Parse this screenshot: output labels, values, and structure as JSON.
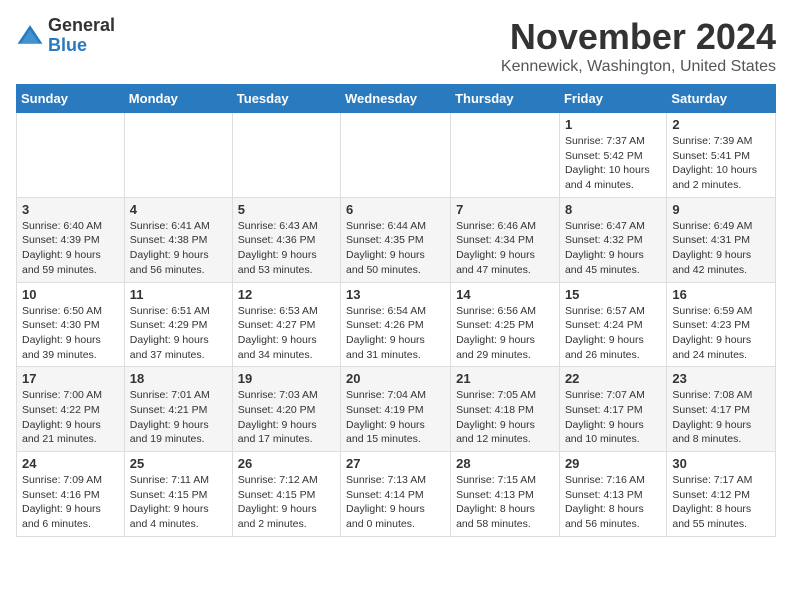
{
  "logo": {
    "line1": "General",
    "line2": "Blue"
  },
  "title": "November 2024",
  "subtitle": "Kennewick, Washington, United States",
  "weekdays": [
    "Sunday",
    "Monday",
    "Tuesday",
    "Wednesday",
    "Thursday",
    "Friday",
    "Saturday"
  ],
  "weeks": [
    [
      {
        "day": "",
        "info": ""
      },
      {
        "day": "",
        "info": ""
      },
      {
        "day": "",
        "info": ""
      },
      {
        "day": "",
        "info": ""
      },
      {
        "day": "",
        "info": ""
      },
      {
        "day": "1",
        "info": "Sunrise: 7:37 AM\nSunset: 5:42 PM\nDaylight: 10 hours and 4 minutes."
      },
      {
        "day": "2",
        "info": "Sunrise: 7:39 AM\nSunset: 5:41 PM\nDaylight: 10 hours and 2 minutes."
      }
    ],
    [
      {
        "day": "3",
        "info": "Sunrise: 6:40 AM\nSunset: 4:39 PM\nDaylight: 9 hours and 59 minutes."
      },
      {
        "day": "4",
        "info": "Sunrise: 6:41 AM\nSunset: 4:38 PM\nDaylight: 9 hours and 56 minutes."
      },
      {
        "day": "5",
        "info": "Sunrise: 6:43 AM\nSunset: 4:36 PM\nDaylight: 9 hours and 53 minutes."
      },
      {
        "day": "6",
        "info": "Sunrise: 6:44 AM\nSunset: 4:35 PM\nDaylight: 9 hours and 50 minutes."
      },
      {
        "day": "7",
        "info": "Sunrise: 6:46 AM\nSunset: 4:34 PM\nDaylight: 9 hours and 47 minutes."
      },
      {
        "day": "8",
        "info": "Sunrise: 6:47 AM\nSunset: 4:32 PM\nDaylight: 9 hours and 45 minutes."
      },
      {
        "day": "9",
        "info": "Sunrise: 6:49 AM\nSunset: 4:31 PM\nDaylight: 9 hours and 42 minutes."
      }
    ],
    [
      {
        "day": "10",
        "info": "Sunrise: 6:50 AM\nSunset: 4:30 PM\nDaylight: 9 hours and 39 minutes."
      },
      {
        "day": "11",
        "info": "Sunrise: 6:51 AM\nSunset: 4:29 PM\nDaylight: 9 hours and 37 minutes."
      },
      {
        "day": "12",
        "info": "Sunrise: 6:53 AM\nSunset: 4:27 PM\nDaylight: 9 hours and 34 minutes."
      },
      {
        "day": "13",
        "info": "Sunrise: 6:54 AM\nSunset: 4:26 PM\nDaylight: 9 hours and 31 minutes."
      },
      {
        "day": "14",
        "info": "Sunrise: 6:56 AM\nSunset: 4:25 PM\nDaylight: 9 hours and 29 minutes."
      },
      {
        "day": "15",
        "info": "Sunrise: 6:57 AM\nSunset: 4:24 PM\nDaylight: 9 hours and 26 minutes."
      },
      {
        "day": "16",
        "info": "Sunrise: 6:59 AM\nSunset: 4:23 PM\nDaylight: 9 hours and 24 minutes."
      }
    ],
    [
      {
        "day": "17",
        "info": "Sunrise: 7:00 AM\nSunset: 4:22 PM\nDaylight: 9 hours and 21 minutes."
      },
      {
        "day": "18",
        "info": "Sunrise: 7:01 AM\nSunset: 4:21 PM\nDaylight: 9 hours and 19 minutes."
      },
      {
        "day": "19",
        "info": "Sunrise: 7:03 AM\nSunset: 4:20 PM\nDaylight: 9 hours and 17 minutes."
      },
      {
        "day": "20",
        "info": "Sunrise: 7:04 AM\nSunset: 4:19 PM\nDaylight: 9 hours and 15 minutes."
      },
      {
        "day": "21",
        "info": "Sunrise: 7:05 AM\nSunset: 4:18 PM\nDaylight: 9 hours and 12 minutes."
      },
      {
        "day": "22",
        "info": "Sunrise: 7:07 AM\nSunset: 4:17 PM\nDaylight: 9 hours and 10 minutes."
      },
      {
        "day": "23",
        "info": "Sunrise: 7:08 AM\nSunset: 4:17 PM\nDaylight: 9 hours and 8 minutes."
      }
    ],
    [
      {
        "day": "24",
        "info": "Sunrise: 7:09 AM\nSunset: 4:16 PM\nDaylight: 9 hours and 6 minutes."
      },
      {
        "day": "25",
        "info": "Sunrise: 7:11 AM\nSunset: 4:15 PM\nDaylight: 9 hours and 4 minutes."
      },
      {
        "day": "26",
        "info": "Sunrise: 7:12 AM\nSunset: 4:15 PM\nDaylight: 9 hours and 2 minutes."
      },
      {
        "day": "27",
        "info": "Sunrise: 7:13 AM\nSunset: 4:14 PM\nDaylight: 9 hours and 0 minutes."
      },
      {
        "day": "28",
        "info": "Sunrise: 7:15 AM\nSunset: 4:13 PM\nDaylight: 8 hours and 58 minutes."
      },
      {
        "day": "29",
        "info": "Sunrise: 7:16 AM\nSunset: 4:13 PM\nDaylight: 8 hours and 56 minutes."
      },
      {
        "day": "30",
        "info": "Sunrise: 7:17 AM\nSunset: 4:12 PM\nDaylight: 8 hours and 55 minutes."
      }
    ]
  ]
}
